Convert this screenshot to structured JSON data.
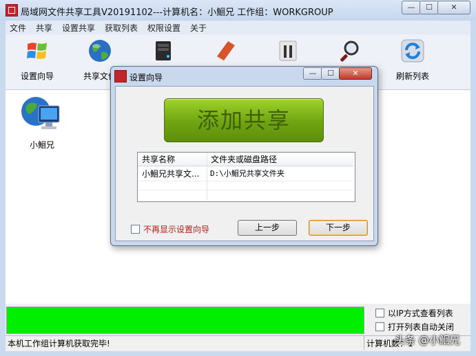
{
  "window": {
    "title": "局域网文件共享工具V20191102---计算机名：小鮰兄  工作组：WORKGROUP",
    "caption_min": "—",
    "caption_max": "☐",
    "caption_close": "✕"
  },
  "menu": [
    "文件",
    "共享",
    "设置共享",
    "获取列表",
    "权限设置",
    "关于"
  ],
  "toolbar": [
    {
      "label": "设置向导",
      "icon": "windows-logo-icon"
    },
    {
      "label": "共享文件",
      "icon": "globe-icon"
    },
    {
      "label": "",
      "icon": "server-icon"
    },
    {
      "label": "",
      "icon": "book-icon"
    },
    {
      "label": "",
      "icon": "tools-icon"
    },
    {
      "label": "",
      "icon": "magnifier-icon"
    },
    {
      "label": "刷新列表",
      "icon": "refresh-icon"
    }
  ],
  "computers": [
    {
      "name": "小鮰兄",
      "icon": "network-computer-icon"
    }
  ],
  "dialog": {
    "title": "设置向导",
    "add_share_button": "添加共享",
    "table": {
      "columns": [
        "共享名称",
        "文件夹或磁盘路径"
      ],
      "rows": [
        [
          "小鮰兄共享文...",
          "D:\\小鮰兄共享文件夹"
        ]
      ]
    },
    "no_more_checkbox": "不再显示设置向导",
    "prev_button": "上一步",
    "next_button": "下一步"
  },
  "options": {
    "ip_view": "以IP方式查看列表",
    "auto_close": "打开列表自动关闭"
  },
  "progress": {
    "value": 1.0,
    "color": "#00ee00"
  },
  "status": {
    "left": "本机工作组计算机获取完毕!",
    "right": "计算机数：1"
  },
  "watermark": "头条 @小鮰兄"
}
